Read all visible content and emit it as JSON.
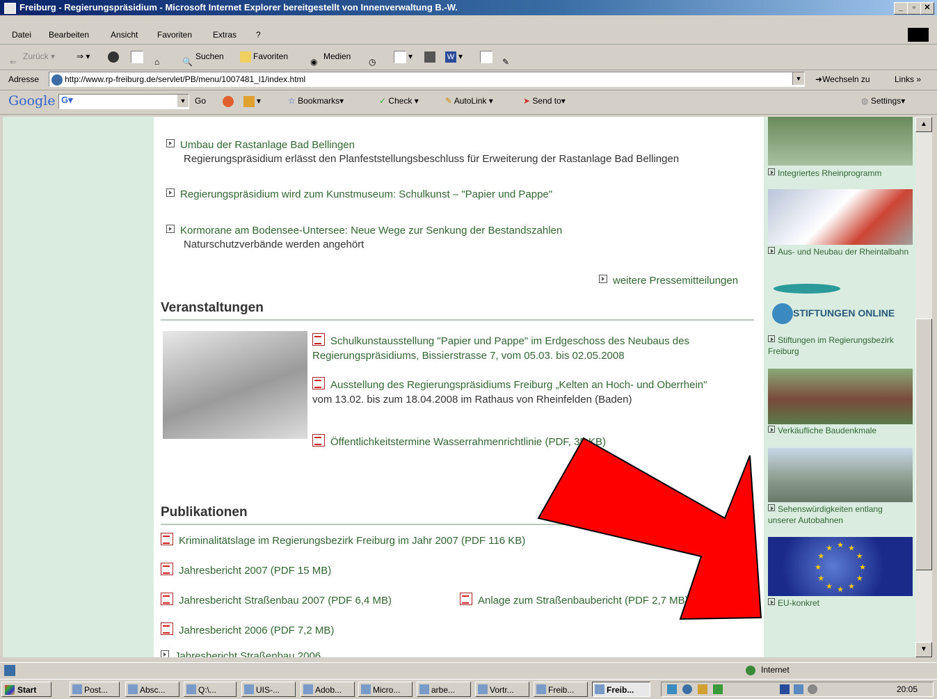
{
  "window": {
    "title": "Freiburg - Regierungspräsidium - Microsoft Internet Explorer bereitgestellt von Innenverwaltung B.-W."
  },
  "menu": [
    "Datei",
    "Bearbeiten",
    "Ansicht",
    "Favoriten",
    "Extras",
    "?"
  ],
  "toolbar": {
    "back": "Zurück",
    "search": "Suchen",
    "favorites": "Favoriten",
    "media": "Medien"
  },
  "address": {
    "label": "Adresse",
    "url": "http://www.rp-freiburg.de/servlet/PB/menu/1007481_l1/index.html",
    "go": "Wechseln zu",
    "links": "Links"
  },
  "google": {
    "logo": "Google",
    "go": "Go",
    "bookmarks": "Bookmarks",
    "check": "Check",
    "autolink": "AutoLink",
    "sendto": "Send to",
    "settings": "Settings"
  },
  "news": [
    {
      "title": "Umbau der Rastanlage Bad Bellingen",
      "subtitle": "Regierungspräsidium erlässt den Planfeststellungsbeschluss für Erweiterung der Rastanlage Bad Bellingen"
    },
    {
      "title": "Regierungspräsidium wird zum Kunstmuseum: Schulkunst – \"Papier und Pappe\"",
      "subtitle": ""
    },
    {
      "title": "Kormorane am Bodensee-Untersee: Neue Wege zur Senkung der Bestandszahlen",
      "subtitle": "Naturschutzverbände werden angehört"
    }
  ],
  "more_press": "weitere Pressemitteilungen",
  "events": {
    "heading": "Veranstaltungen",
    "items": [
      {
        "link": "Schulkunstausstellung \"Papier und Pappe\" im Erdgeschoss des Neubaus des Regierungspräsidiums, Bissierstrasse 7, vom 05.03. bis 02.05.2008",
        "note": ""
      },
      {
        "link": "Ausstellung des Regierungspräsidiums Freiburg „Kelten an Hoch- und Oberrhein\"",
        "note": "vom 13.02. bis zum 18.04.2008 im Rathaus von Rheinfelden (Baden)"
      },
      {
        "link": "Öffentlichkeitstermine Wasserrahmenrichtlinie (PDF, 35 KB)",
        "note": ""
      }
    ]
  },
  "publications": {
    "heading": "Publikationen",
    "items": [
      "Kriminalitätslage im Regierungsbezirk Freiburg im Jahr 2007 (PDF 116 KB)",
      "Jahresbericht 2007 (PDF 15 MB)",
      "Jahresbericht Straßenbau 2007 (PDF 6,4 MB)",
      "Anlage zum Straßenbaubericht (PDF 2,7 MB)",
      "Jahresbericht 2006 (PDF 7,2 MB)",
      "Jahresbericht Straßenbau 2006"
    ]
  },
  "sidebar": [
    "Integriertes Rheinprogramm",
    "Aus- und Neubau der Rheintalbahn",
    "STIFTUNGEN ONLINE",
    "Stiftungen im Regierungsbezirk Freiburg",
    "Verkäufliche Baudenkmale",
    "Sehenswürdigkeiten entlang unserer Autobahnen",
    "EU-konkret"
  ],
  "status": {
    "zone": "Internet"
  },
  "taskbar": {
    "start": "Start",
    "tasks": [
      "Post...",
      "Absc...",
      "Q:\\...",
      "UIS-...",
      "Adob...",
      "Micro...",
      "arbe...",
      "Vortr...",
      "Freib...",
      "Freib..."
    ],
    "clock": "20:05"
  },
  "colors": {
    "link": "#336633",
    "panel": "#d9ecdf",
    "arrow": "#ff0000"
  }
}
